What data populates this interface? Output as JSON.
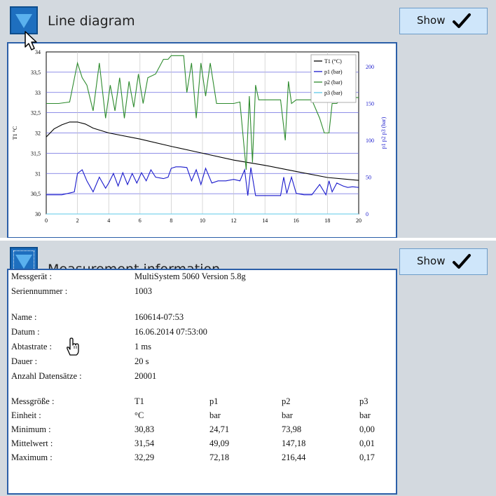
{
  "panel_line": {
    "title": "Line diagram",
    "show_label": "Show"
  },
  "panel_info": {
    "title": "Measurement information",
    "show_label": "Show"
  },
  "icons": [
    "triangle-down-icon",
    "checkmark-icon",
    "arrow-cursor-icon",
    "hand-cursor-icon"
  ],
  "colors": {
    "panel_bg": "#d3d9df",
    "toggle_blue": "#1e6fbf",
    "frame_blue": "#2b5fa8",
    "button_bg": "#cfe6fa",
    "T1": "#000000",
    "p1": "#1a1acc",
    "p2": "#2e8b2e",
    "p3": "#5ec8e8"
  },
  "chart_data": {
    "type": "line",
    "xlim": [
      0,
      20
    ],
    "x_ticks": [
      "0",
      "2",
      "4",
      "6",
      "8",
      "10",
      "12",
      "14",
      "16",
      "18",
      "20"
    ],
    "y_left_ticks": [
      "30",
      "30,5",
      "31",
      "31,5",
      "32",
      "32,5",
      "33",
      "33,5",
      "34"
    ],
    "y_left_label": "T1 °C",
    "ylim_left": [
      30,
      34
    ],
    "y_right_ticks": [
      "0",
      "50",
      "100",
      "150",
      "200"
    ],
    "y_right_label": "p1 p2 p3 (bar)",
    "ylim_right": [
      0,
      220
    ],
    "grid": true,
    "legend_position": "top-right",
    "series": [
      {
        "name": "T1 (°C)",
        "axis": "left",
        "color": "#000000",
        "x": [
          0,
          0.5,
          1,
          1.5,
          2,
          2.5,
          3,
          4,
          6,
          8,
          10,
          12,
          14,
          16,
          18,
          20
        ],
        "y": [
          31.9,
          32.1,
          32.2,
          32.27,
          32.27,
          32.22,
          32.12,
          32.0,
          31.85,
          31.67,
          31.5,
          31.33,
          31.2,
          31.05,
          30.9,
          30.83
        ]
      },
      {
        "name": "p1 (bar)",
        "axis": "right",
        "color": "#1a1acc",
        "x": [
          0,
          1,
          1.8,
          2,
          2.3,
          2.6,
          3,
          3.4,
          3.8,
          4,
          4.3,
          4.6,
          4.9,
          5.2,
          5.5,
          5.8,
          6.1,
          6.4,
          6.7,
          7,
          7.5,
          7.8,
          8,
          8.3,
          8.6,
          9,
          9.3,
          9.6,
          9.9,
          10.2,
          10.6,
          11,
          11.5,
          12,
          12.4,
          12.7,
          12.9,
          13.1,
          13.4,
          14,
          14.5,
          15,
          15.2,
          15.4,
          15.7,
          16,
          16.5,
          17,
          17.5,
          17.9,
          18.1,
          18.3,
          18.6,
          19,
          19.3,
          19.6,
          20
        ],
        "y": [
          26,
          26,
          30,
          55,
          60,
          45,
          30,
          50,
          35,
          42,
          55,
          38,
          56,
          40,
          55,
          42,
          56,
          45,
          60,
          50,
          48,
          50,
          62,
          64,
          64,
          63,
          45,
          60,
          40,
          62,
          42,
          45,
          45,
          47,
          45,
          60,
          25,
          63,
          25,
          25,
          25,
          25,
          50,
          28,
          50,
          28,
          26,
          26,
          40,
          26,
          45,
          30,
          42,
          38,
          36,
          37,
          36
        ]
      },
      {
        "name": "p2 (bar)",
        "axis": "right",
        "color": "#2e8b2e",
        "x": [
          0,
          0.8,
          1.5,
          2,
          2.3,
          2.6,
          3,
          3.4,
          3.8,
          4.1,
          4.4,
          4.7,
          5,
          5.3,
          5.6,
          5.9,
          6.2,
          6.5,
          7,
          7.5,
          7.8,
          8,
          8.3,
          8.8,
          9,
          9.3,
          9.6,
          9.9,
          10.2,
          10.5,
          10.9,
          11.3,
          12,
          12.4,
          12.8,
          13,
          13.2,
          13.4,
          13.6,
          14,
          14.5,
          15,
          15.3,
          15.5,
          15.7,
          16,
          16.5,
          17,
          17.5,
          17.8,
          18.1,
          18.3,
          18.6,
          19,
          19.5,
          20
        ],
        "y": [
          150,
          150,
          152,
          205,
          185,
          175,
          140,
          205,
          130,
          175,
          140,
          185,
          130,
          180,
          145,
          190,
          150,
          185,
          190,
          210,
          210,
          215,
          215,
          215,
          165,
          205,
          130,
          205,
          160,
          205,
          150,
          150,
          150,
          152,
          60,
          160,
          70,
          175,
          155,
          155,
          155,
          155,
          100,
          180,
          150,
          155,
          155,
          155,
          130,
          110,
          110,
          150,
          150,
          160,
          158,
          158
        ]
      },
      {
        "name": "p3 (bar)",
        "axis": "right",
        "color": "#5ec8e8",
        "x": [
          0,
          20
        ],
        "y": [
          0,
          0
        ]
      }
    ]
  },
  "info": {
    "device": {
      "label": "Messgerät :",
      "value": "MultiSystem 5060  Version 5.8g"
    },
    "serial": {
      "label": "Seriennummer :",
      "value": "1003"
    },
    "name": {
      "label": "Name :",
      "value": "160614-07:53"
    },
    "date": {
      "label": "Datum :",
      "value": "16.06.2014 07:53:00"
    },
    "rate": {
      "label": "Abtastrate :",
      "value": "1 ms"
    },
    "duration": {
      "label": "Dauer :",
      "value": "20 s"
    },
    "records": {
      "label": "Anzahl Datensätze :",
      "value": "20001"
    },
    "table": {
      "rows": [
        {
          "label": "Messgröße :",
          "cells": [
            "T1",
            "p1",
            "p2",
            "p3"
          ]
        },
        {
          "label": "Einheit :",
          "cells": [
            "°C",
            "bar",
            "bar",
            "bar"
          ]
        },
        {
          "label": "Minimum :",
          "cells": [
            "30,83",
            "24,71",
            "73,98",
            "0,00"
          ]
        },
        {
          "label": "Mittelwert :",
          "cells": [
            "31,54",
            "49,09",
            "147,18",
            "0,01"
          ]
        },
        {
          "label": "Maximum :",
          "cells": [
            "32,29",
            "72,18",
            "216,44",
            "0,17"
          ]
        }
      ]
    }
  }
}
